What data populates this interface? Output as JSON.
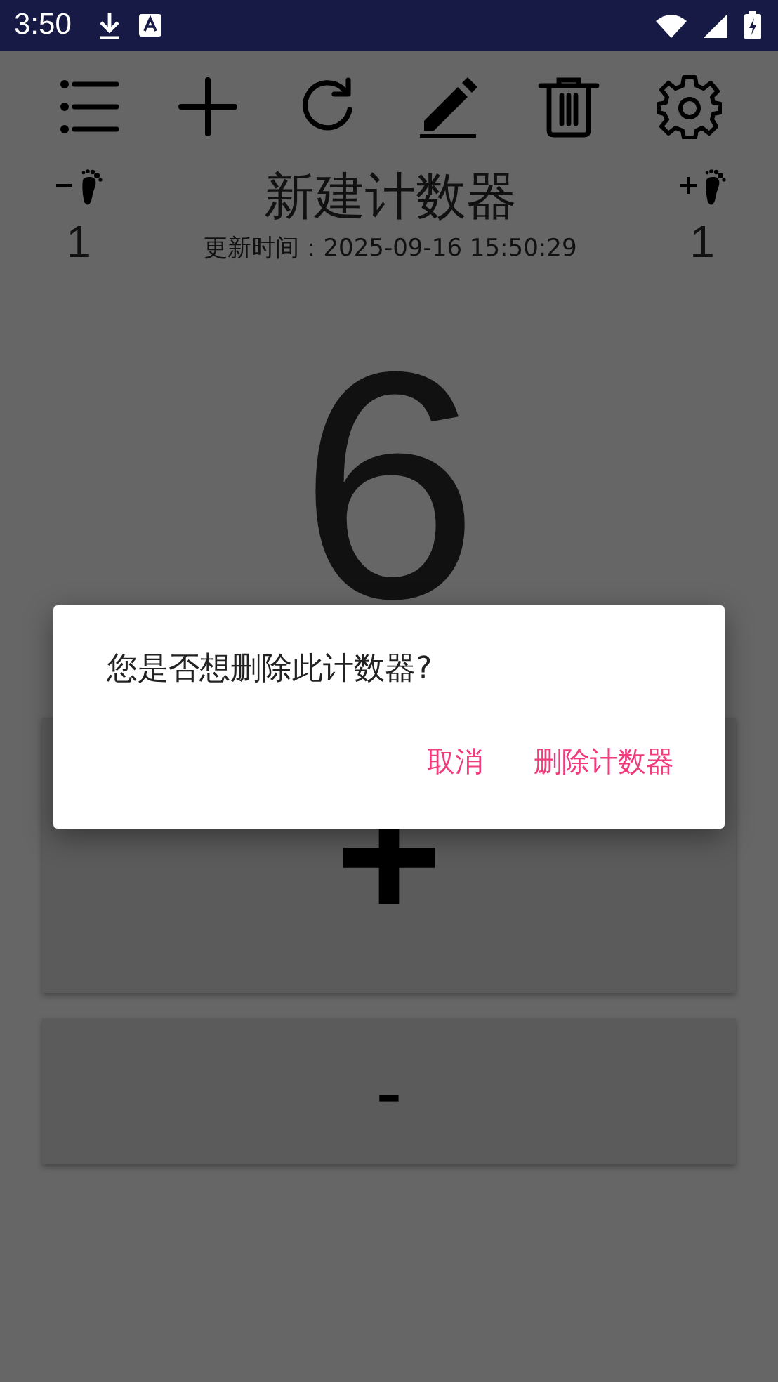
{
  "status_bar": {
    "time": "3:50"
  },
  "counter": {
    "step_down": "1",
    "title": "新建计数器",
    "updated": "更新时间：2025-09-16 15:50:29",
    "step_up": "1",
    "value": "6",
    "increment_label": "+",
    "decrement_label": "-"
  },
  "dialog": {
    "message": "您是否想删除此计数器?",
    "buttons": [
      "取消",
      "删除计数器"
    ]
  }
}
